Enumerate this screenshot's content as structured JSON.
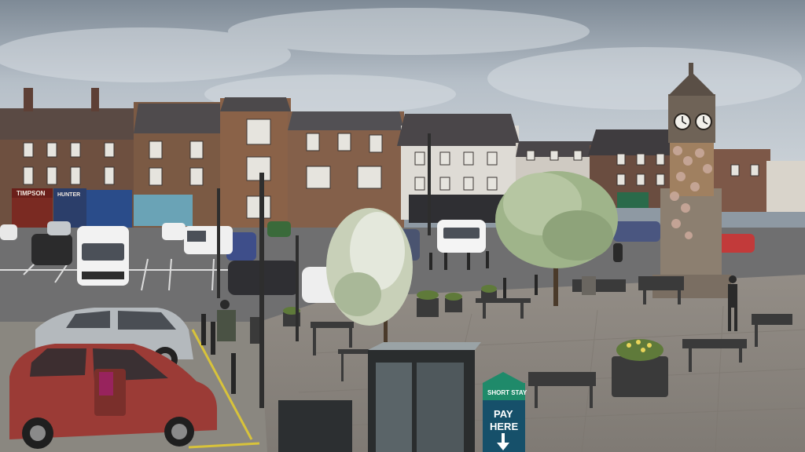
{
  "scene": {
    "description_type": "webcam-town-square",
    "shop_signs": {
      "left_shop": "TIMPSON",
      "second_shop": "HUNTER"
    },
    "parking_sign": {
      "top_line": "SHORT STAY",
      "bottom_line_1": "PAY",
      "bottom_line_2": "HERE",
      "arrow": "down-arrow-icon"
    },
    "clock_tower": {
      "clock_faces": 2,
      "time_shown": "approx 1:40"
    },
    "colors": {
      "sky": "#a9b4be",
      "pavement": "#8d8780",
      "road": "#6f6f70",
      "brick": "#7a5a45",
      "sign_green": "#1f8a6a",
      "red_car": "#9b3b36"
    }
  }
}
